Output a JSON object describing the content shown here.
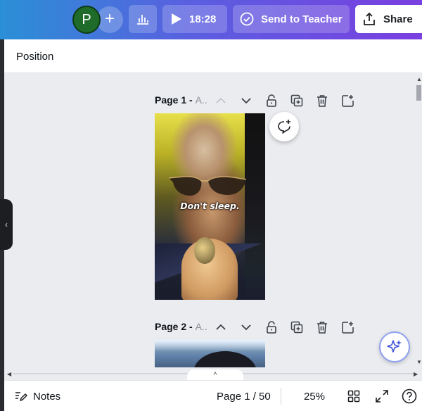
{
  "header": {
    "avatar_initial": "P",
    "add_collaborator": "+",
    "present_time": "18:28",
    "send_to_teacher": "Send to Teacher",
    "share": "Share"
  },
  "panel": {
    "title": "Position"
  },
  "pages": [
    {
      "label": "Page 1 - ",
      "title_truncated": "A..",
      "thumb_caption": "Don't sleep."
    },
    {
      "label": "Page 2 - ",
      "title_truncated": "A.."
    }
  ],
  "footer": {
    "notes": "Notes",
    "page_indicator": "Page 1 / 50",
    "zoom": "25%"
  },
  "icons": {
    "collapse": "‹",
    "scroll_up": "▲",
    "scroll_down": "▼",
    "scroll_left": "◀",
    "scroll_right": "▶",
    "scroll_to_top": "^"
  },
  "colors": {
    "brand_gradient_start": "#2a8fd6",
    "brand_gradient_end": "#7a3fe0",
    "avatar_bg": "#1f6b2a",
    "canvas_bg": "#ebecf0"
  }
}
